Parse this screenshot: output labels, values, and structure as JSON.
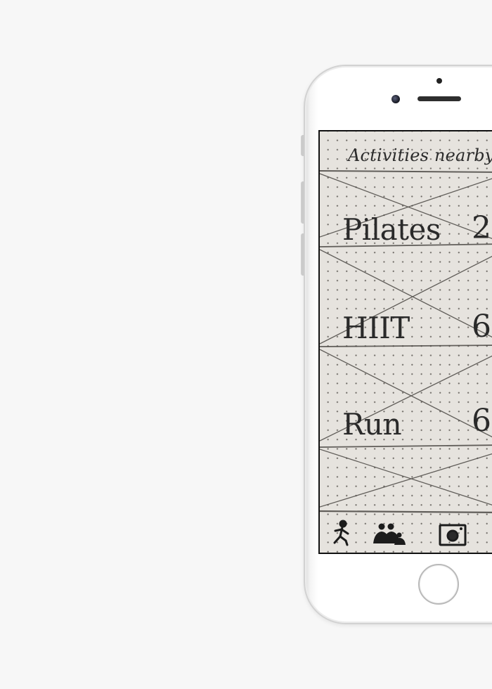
{
  "screen": {
    "header": {
      "title": "Activities nearby"
    },
    "activities": [
      {
        "name": "Pilates",
        "value": "2"
      },
      {
        "name": "HIIT",
        "value": "6"
      },
      {
        "name": "Run",
        "value": "6"
      }
    ],
    "tab_bar": {
      "items": [
        {
          "icon": "runner-icon"
        },
        {
          "icon": "group-icon"
        },
        {
          "icon": "camera-icon"
        }
      ]
    }
  },
  "colors": {
    "paper": "#e6e3de",
    "pencil": "#2a2a2a",
    "phone_body": "#ffffff",
    "background": "#f7f7f7"
  }
}
